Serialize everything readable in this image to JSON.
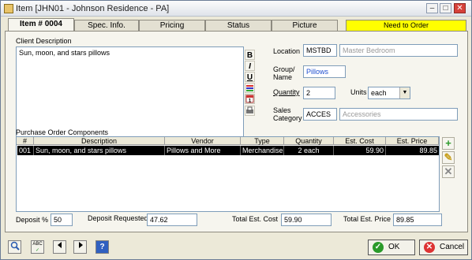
{
  "window": {
    "title": "Item [JHN01 - Johnson Residence - PA]"
  },
  "tabs": [
    {
      "label": "Item # 0004"
    },
    {
      "label": "Spec. Info."
    },
    {
      "label": "Pricing"
    },
    {
      "label": "Status"
    },
    {
      "label": "Picture"
    },
    {
      "label": "Need to Order"
    }
  ],
  "client_description": {
    "label": "Client Description",
    "value": "Sun, moon, and stars pillows"
  },
  "format_buttons": [
    "B",
    "I",
    "U"
  ],
  "location": {
    "label": "Location",
    "code": "MSTBD",
    "name": "Master Bedroom"
  },
  "group": {
    "label_line1": "Group/",
    "label_line2": "Name",
    "value": "Pillows"
  },
  "quantity": {
    "label": "Quantity",
    "value": "2"
  },
  "units": {
    "label": "Units",
    "value": "each"
  },
  "sales_category": {
    "label_line1": "Sales",
    "label_line2": "Category",
    "code": "ACCES",
    "name": "Accessories"
  },
  "components": {
    "label": "Purchase Order Components",
    "columns": [
      "#",
      "Description",
      "Vendor",
      "Type",
      "Quantity",
      "Est. Cost",
      "Est. Price"
    ],
    "rows": [
      {
        "num": "001",
        "description": "Sun, moon, and stars pillows",
        "vendor": "Pillows and More",
        "type": "Merchandise",
        "quantity": "2 each",
        "cost": "59.90",
        "price": "89.85"
      }
    ]
  },
  "totals": {
    "deposit_pct_label": "Deposit %",
    "deposit_pct": "50",
    "deposit_req_label": "Deposit Requested",
    "deposit_req": "47.62",
    "cost_label": "Total Est. Cost",
    "cost": "59.90",
    "price_label": "Total Est. Price",
    "price": "89.85"
  },
  "actions": {
    "ok": "OK",
    "cancel": "Cancel"
  },
  "colors": {
    "need_to_order": "#ffff00",
    "selected_row": "#000000"
  }
}
